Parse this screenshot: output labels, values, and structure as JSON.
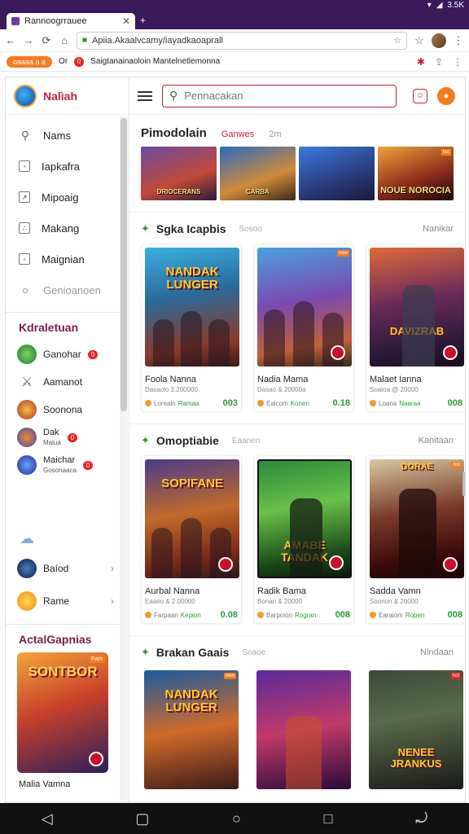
{
  "status_bar": {
    "right_text": "3.5K"
  },
  "browser": {
    "tab_title": "Rannoogrrauee",
    "new_tab_label": "+",
    "url": "Apiia.Akaalvcamy/iayadkaoaprall",
    "infobar": {
      "pill": "oaaaa a a",
      "text_prefix": "Or",
      "badge": "0",
      "text": "Saigtanainaoloin Mantelnetlemonna"
    }
  },
  "sidebar": {
    "brand": "Nalìah",
    "menu": [
      {
        "label": "Nams",
        "icon": "search-icon"
      },
      {
        "label": "Iapkafra",
        "icon": "grid-icon"
      },
      {
        "label": "Mipoaig",
        "icon": "chart-icon"
      },
      {
        "label": "Makang",
        "icon": "grid-icon"
      },
      {
        "label": "Maignian",
        "icon": "grid-icon"
      },
      {
        "label": "Genioanoen",
        "icon": "circle-icon",
        "muted": true
      }
    ],
    "categories_heading": "Kdraletuan",
    "categories": [
      {
        "label": "Ganohar",
        "badge": "0"
      },
      {
        "label": "Aamanot"
      },
      {
        "label": "Soonona"
      },
      {
        "label": "Dak",
        "sub": "Maiua",
        "badge": "0"
      },
      {
        "label": "Maichar",
        "sub": "Gosonaaca",
        "badge": "0"
      }
    ],
    "bottom_items": [
      {
        "label": "Baíod"
      },
      {
        "label": "Rame"
      }
    ],
    "actual_heading": "ActalGapnias",
    "side_card": {
      "art_title": "SONTBOR",
      "tag": "Fam",
      "title": "Malia Vamna"
    }
  },
  "main": {
    "search_placeholder": "Pennacakan",
    "promo": {
      "heading": "Pimodolain",
      "tab_active": "Ganwes",
      "tab": "2m",
      "banners": [
        {
          "text": "DRIOCERANS"
        },
        {
          "text": "CARBA"
        },
        {
          "text": ""
        },
        {
          "text": "NOUE NOROCIA",
          "tag": "hot"
        }
      ]
    },
    "sections": [
      {
        "title": "Sgka Icapbis",
        "sub": "Sosoo",
        "more": "Nanikar",
        "cards": [
          {
            "art_title": "NANDAK LUNGER",
            "name": "Foola Nanna",
            "meta": "Dasaolo 2.200000",
            "label": "Lorealn",
            "label2": "Ramaa",
            "score": "003"
          },
          {
            "art_title": "",
            "tag": "new",
            "name": "Nadia Mama",
            "meta": "Dasao & 20000a",
            "label": "Ealcom",
            "label2": "Konen",
            "score": "0.18"
          },
          {
            "art_title": "DAVIZRAB",
            "name": "Malaet Ianna",
            "meta": "Soaioa @ 20000",
            "label": "Loana",
            "label2": "Naaraa",
            "score": "008"
          }
        ]
      },
      {
        "title": "Omoptiabie",
        "sub": "Eaanen",
        "more": "Kanitaan",
        "cards": [
          {
            "art_title": "SOPIFANE",
            "name": "Aurbal Nanna",
            "meta": "Eaaeo & 2.00000",
            "label": "Farpaan",
            "label2": "Kepion",
            "score": "0.08"
          },
          {
            "art_title": "AMABE TANDAK",
            "name": "Radik Bama",
            "meta": "Bonan & 20000",
            "label": "Barpoion",
            "label2": "Rogran",
            "score": "008"
          },
          {
            "art_title": "DORAE",
            "tag": "hot",
            "name": "Sadda Vamn",
            "meta": "Soonon & 20000",
            "label": "Earaiom",
            "label2": "Ropen",
            "score": "008"
          }
        ]
      },
      {
        "title": "Brakan Gaais",
        "sub": "Soaoe",
        "more": "Nlndaan",
        "cards": [
          {
            "art_title": "NANDAK LUNGER",
            "tag": "new"
          },
          {
            "art_title": ""
          },
          {
            "art_title": "NENEE JRANKUS",
            "tag": "hot"
          }
        ]
      }
    ]
  },
  "colors": {
    "brand_red": "#c0203a",
    "accent_orange": "#f47b20",
    "score_green": "#2a9a3a",
    "chrome_purple": "#3a1a5a"
  }
}
